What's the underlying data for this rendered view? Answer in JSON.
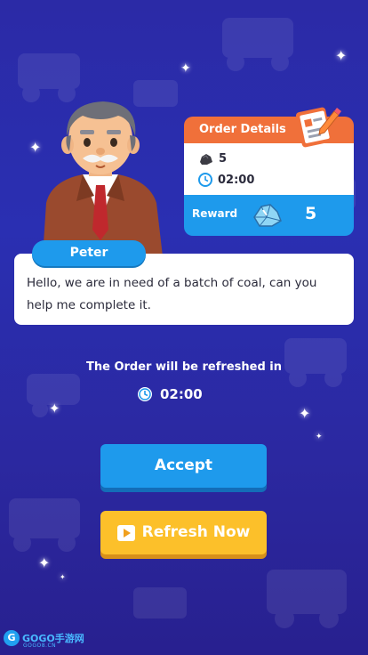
{
  "order": {
    "header": "Order Details",
    "coal_amount": "5",
    "time": "02:00",
    "reward_label": "Reward",
    "reward_value": "5"
  },
  "npc": {
    "name": "Peter",
    "dialog": "Hello, we are in need of a batch of coal, can you help me complete it."
  },
  "refresh": {
    "info": "The Order will be refreshed in",
    "timer": "02:00"
  },
  "buttons": {
    "accept": "Accept",
    "refresh_now": "Refresh Now"
  },
  "watermark": {
    "brand": "GOGO手游网",
    "sub": "GOGO8.CN"
  },
  "colors": {
    "background": "#2b2aa6",
    "order_header": "#f0703a",
    "accent_blue": "#1e9aec",
    "refresh_yellow": "#fcc02a"
  },
  "icons": [
    "coal-icon",
    "clock-icon",
    "crystal-icon",
    "clipboard-icon",
    "play-icon"
  ]
}
